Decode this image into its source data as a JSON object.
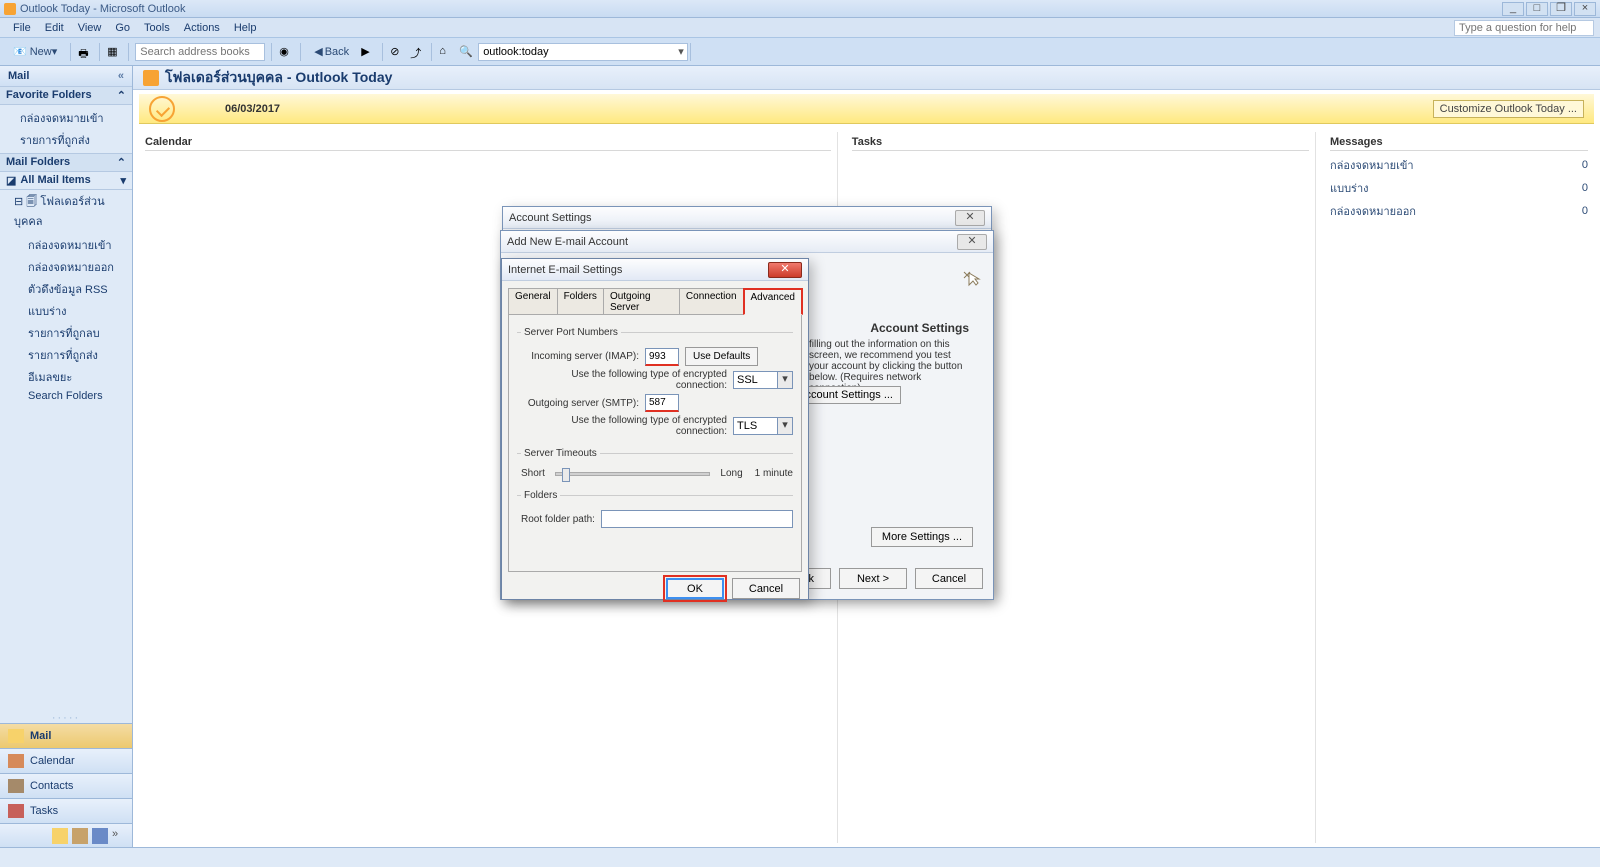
{
  "app": {
    "title": "Outlook Today - Microsoft Outlook"
  },
  "menu": {
    "file": "File",
    "edit": "Edit",
    "view": "View",
    "go": "Go",
    "tools": "Tools",
    "actions": "Actions",
    "help": "Help",
    "help_placeholder": "Type a question for help"
  },
  "toolbar": {
    "new": "New",
    "back": "Back",
    "search_placeholder": "Search address books",
    "addr_value": "outlook:today"
  },
  "nav": {
    "section_title": "Mail",
    "fav_header": "Favorite Folders",
    "fav": [
      "กล่องจดหมายเข้า",
      "รายการที่ถูกส่ง"
    ],
    "mail_header": "Mail Folders",
    "all": "All Mail Items",
    "root": "โฟลเดอร์ส่วนบุคคล",
    "folders": [
      "กล่องจดหมายเข้า",
      "กล่องจดหมายออก",
      "ตัวดึงข้อมูล RSS",
      "แบบร่าง",
      "รายการที่ถูกลบ",
      "รายการที่ถูกส่ง",
      "อีเมลขยะ",
      "Search Folders"
    ],
    "btns": {
      "mail": "Mail",
      "calendar": "Calendar",
      "contacts": "Contacts",
      "tasks": "Tasks"
    }
  },
  "content": {
    "title": "โฟลเดอร์ส่วนบุคคล - Outlook Today",
    "date": "06/03/2017",
    "customize": "Customize Outlook Today ...",
    "calendar": "Calendar",
    "tasks": "Tasks",
    "messages_h": "Messages",
    "messages": [
      {
        "label": "กล่องจดหมายเข้า",
        "count": "0"
      },
      {
        "label": "แบบร่าง",
        "count": "0"
      },
      {
        "label": "กล่องจดหมายออก",
        "count": "0"
      }
    ]
  },
  "dlg1": {
    "title": "Account Settings"
  },
  "dlg2": {
    "title": "Add New E-mail Account",
    "heading": "Account Settings",
    "para": "filling out the information on this screen, we recommend you test your account by clicking the button below. (Requires network connection)",
    "test": "Account Settings ...",
    "more": "More Settings ...",
    "back": "< Back",
    "next": "Next >",
    "cancel": "Cancel"
  },
  "dlg3": {
    "title": "Internet E-mail Settings",
    "tabs": {
      "general": "General",
      "folders": "Folders",
      "outgoing": "Outgoing Server",
      "connection": "Connection",
      "advanced": "Advanced"
    },
    "grp_ports": "Server Port Numbers",
    "imap_lbl": "Incoming server (IMAP):",
    "imap_val": "993",
    "use_defaults": "Use Defaults",
    "enc_lbl": "Use the following type of encrypted connection:",
    "ssl": "SSL",
    "smtp_lbl": "Outgoing server (SMTP):",
    "smtp_val": "587",
    "tls": "TLS",
    "grp_timeouts": "Server Timeouts",
    "short": "Short",
    "long": "Long",
    "timeout": "1 minute",
    "grp_folders": "Folders",
    "root_lbl": "Root folder path:",
    "root_val": "",
    "ok": "OK",
    "cancel": "Cancel"
  }
}
